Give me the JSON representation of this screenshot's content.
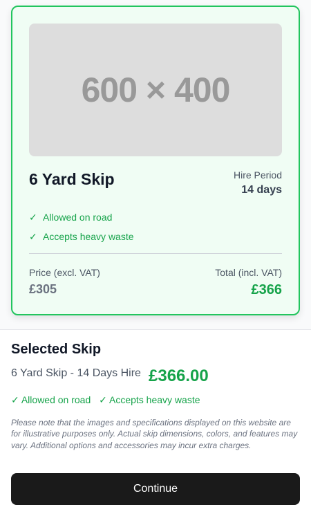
{
  "card": {
    "image_text": "600 × 400",
    "name": "6 Yard Skip",
    "hire_period_label": "Hire Period",
    "hire_period_value": "14 days",
    "features": [
      {
        "icon": "check-icon",
        "text": "Allowed on road"
      },
      {
        "icon": "check-icon",
        "text": "Accepts heavy waste"
      }
    ],
    "price_label": "Price (excl. VAT)",
    "price_value": "£305",
    "total_label": "Total (incl. VAT)",
    "total_value": "£366",
    "selected": true
  },
  "summary": {
    "title": "Selected Skip",
    "description": "6 Yard Skip - 14 Days Hire",
    "price": "£366.00",
    "features": [
      "✓ Allowed on road",
      "✓ Accepts heavy waste"
    ],
    "disclaimer": "Please note that the images and specifications displayed on this website are for illustrative purposes only. Actual skip dimensions, colors, and features may vary. Additional options and accessories may incur extra charges."
  },
  "continue_label": "Continue",
  "colors": {
    "accent": "#22c55e",
    "accent_text": "#16a34a",
    "card_bg": "#f0fdf4",
    "button_bg": "#1a1a1a"
  }
}
